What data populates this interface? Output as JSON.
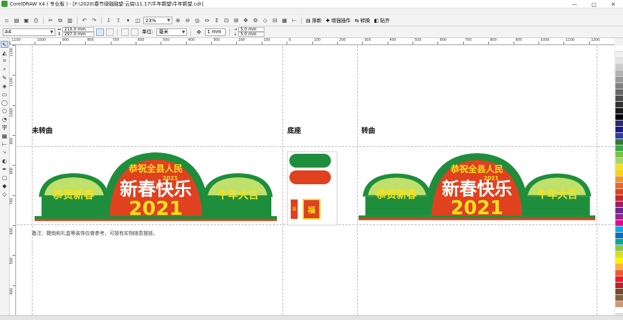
{
  "window": {
    "title": "CorelDRAW X4 ( 专业版 ) - [F:\\2020\\春节绿融融望-云娆\\11.17\\牛年颗望\\牛年颗望.cdr]",
    "controls": [
      "—",
      "▢",
      "✕"
    ]
  },
  "toolbar1": {
    "zoom_value": "23%",
    "snap_label": "贴齐",
    "publish_label": "排新",
    "plugin_label": "增强插件",
    "convert_label": "转换",
    "paste_label": "贴齐"
  },
  "toolbar2": {
    "page_size": "A4",
    "width_value": "210.0 mm",
    "height_value": "297.0 mm",
    "unit_label": "单位:",
    "unit_value": "毫米",
    "nudge_value": "1 mm",
    "dup_x": "5.0 mm",
    "dup_y": "5.0 mm"
  },
  "ruler_top": [
    "1100",
    "1000",
    "900",
    "800",
    "700",
    "600",
    "500",
    "400",
    "300",
    "200",
    "100",
    "0",
    "100",
    "200",
    "300",
    "400",
    "500",
    "600",
    "700",
    "800",
    "900",
    "1000",
    "1100",
    "1200"
  ],
  "ruler_left": [
    "1200",
    "1100",
    "1000",
    "900",
    "800",
    "700",
    "600",
    "500",
    "400"
  ],
  "canvas": {
    "label_left": "未转曲",
    "label_center": "底座",
    "label_right": "转曲",
    "note": "备注：鞭炮和礼盒等装饰仅做参考，可按有实物随意摆放。"
  },
  "artwork": {
    "top_text": "恭祝全县人民",
    "year_small": "2021",
    "main_text": "新春快乐",
    "year_big": "2021",
    "left_fan": "恭贺新春",
    "right_fan": "牛年大吉",
    "fu": "福"
  },
  "colors": {
    "green": "#1f8e3c",
    "red": "#e0411f",
    "yellow": "#f4e21b",
    "light_green": "#bfe06a"
  },
  "palette": [
    "#ffffff",
    "#f2f2f2",
    "#e6e6e6",
    "#cccccc",
    "#b3b3b3",
    "#999999",
    "#808080",
    "#666666",
    "#4d4d4d",
    "#333333",
    "#1a1a1a",
    "#000000",
    "#2a2a6e",
    "#1c1c8c",
    "#2b3ea8",
    "#2e7d32",
    "#3aa84a",
    "#7ac143",
    "#a8d46f",
    "#f4e21b",
    "#ffd200",
    "#f7941d",
    "#f26522",
    "#e0411f",
    "#c1272d",
    "#9e1f63",
    "#662d91",
    "#92278f",
    "#ec008c",
    "#00aeef",
    "#0072bc",
    "#00a99d",
    "#8dc63f",
    "#d7df23",
    "#fff200",
    "#fbb040",
    "#f15a29",
    "#ed1c24",
    "#be1e2d",
    "#754c24",
    "#8b5e3c",
    "#c69c6d",
    "#ffffff"
  ]
}
